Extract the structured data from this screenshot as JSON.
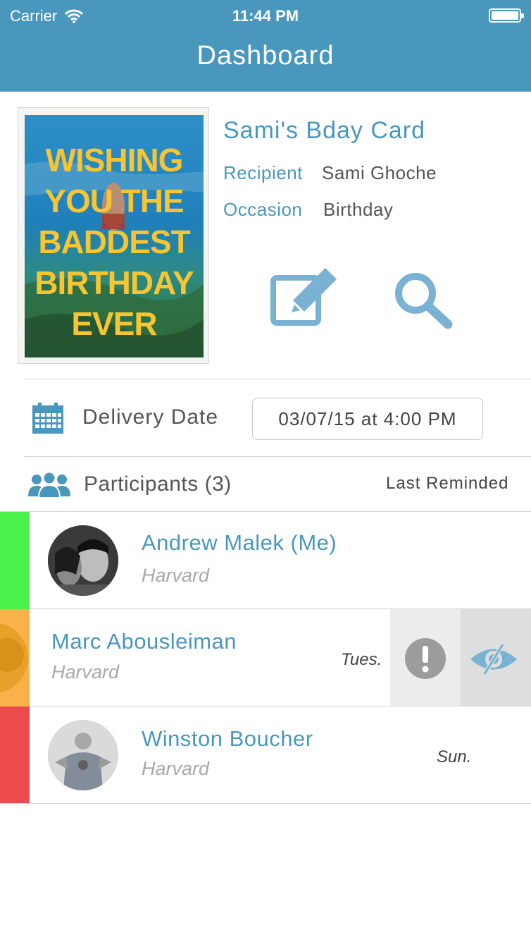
{
  "status_bar": {
    "carrier": "Carrier",
    "time": "11:44 PM"
  },
  "nav": {
    "title": "Dashboard"
  },
  "card": {
    "title": "Sami's Bday Card",
    "recipient_label": "Recipient",
    "recipient_value": "Sami Ghoche",
    "occasion_label": "Occasion",
    "occasion_value": "Birthday",
    "image_text": [
      "WISHING",
      "YOU THE",
      "BADDEST",
      "BIRTHDAY",
      "EVER"
    ],
    "edit_icon": "edit-icon",
    "preview_icon": "search-icon"
  },
  "delivery": {
    "label": "Delivery Date",
    "value": "03/07/15 at 4:00 PM",
    "icon": "calendar-icon"
  },
  "participants": {
    "label": "Participants (3)",
    "last_reminded_label": "Last Reminded",
    "icon": "group-icon",
    "rows": [
      {
        "name": "Andrew Malek (Me)",
        "school": "Harvard",
        "reminded": "",
        "status_color": "#4cf04a"
      },
      {
        "name": "Marc Abousleiman",
        "school": "Harvard",
        "reminded": "Tues.",
        "status_color": "#fbb04a",
        "swipe_actions": [
          "alert-icon",
          "eye-icon"
        ]
      },
      {
        "name": "Winston Boucher",
        "school": "Harvard",
        "reminded": "Sun.",
        "status_color": "#ec4b4d"
      }
    ]
  },
  "colors": {
    "accent": "#4a97be",
    "icon_blue": "#7ab2d3",
    "green": "#4cf04a",
    "orange": "#fbb04a",
    "red": "#ec4b4d"
  }
}
